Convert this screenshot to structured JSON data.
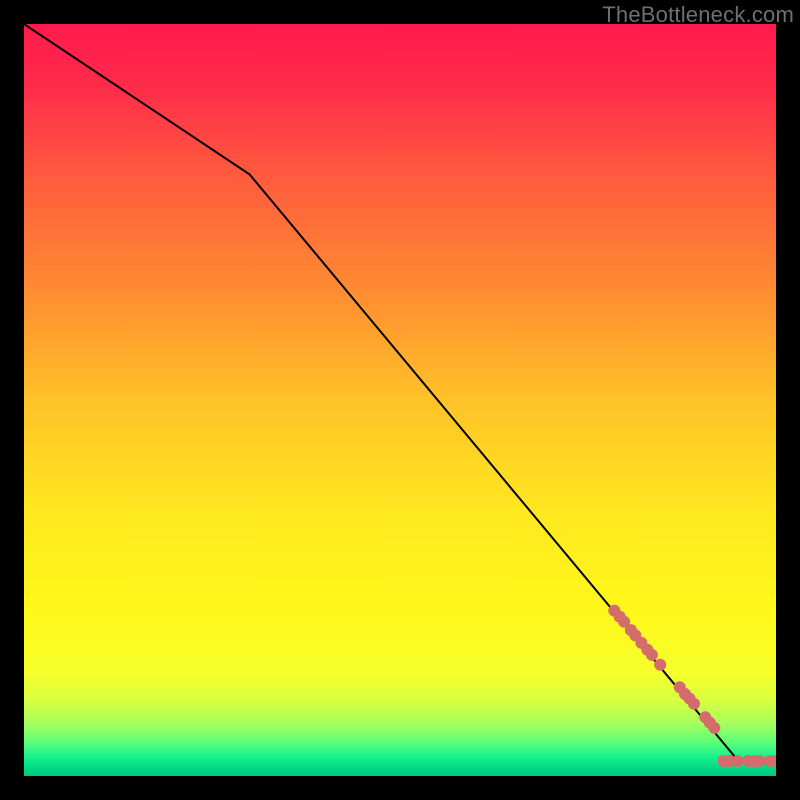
{
  "watermark": "TheBottleneck.com",
  "chart_data": {
    "type": "line",
    "title": "",
    "xlabel": "",
    "ylabel": "",
    "xlim": [
      0,
      100
    ],
    "ylim": [
      0,
      100
    ],
    "background": "heatmap-gradient",
    "line": {
      "x": [
        0,
        30,
        95,
        100
      ],
      "y": [
        100,
        80,
        2,
        2
      ]
    },
    "scatter": {
      "color": "#d46c6c",
      "radius": 6,
      "points": [
        {
          "x": 78.5,
          "y": 22.0
        },
        {
          "x": 79.2,
          "y": 21.2
        },
        {
          "x": 79.8,
          "y": 20.5
        },
        {
          "x": 80.7,
          "y": 19.4
        },
        {
          "x": 81.3,
          "y": 18.7
        },
        {
          "x": 82.1,
          "y": 17.7
        },
        {
          "x": 82.9,
          "y": 16.8
        },
        {
          "x": 83.5,
          "y": 16.1
        },
        {
          "x": 84.6,
          "y": 14.8
        },
        {
          "x": 87.2,
          "y": 11.8
        },
        {
          "x": 87.9,
          "y": 10.9
        },
        {
          "x": 88.5,
          "y": 10.3
        },
        {
          "x": 89.1,
          "y": 9.6
        },
        {
          "x": 90.6,
          "y": 7.8
        },
        {
          "x": 91.2,
          "y": 7.1
        },
        {
          "x": 91.8,
          "y": 6.4
        },
        {
          "x": 93.0,
          "y": 2.0
        },
        {
          "x": 93.8,
          "y": 2.0
        },
        {
          "x": 94.9,
          "y": 2.0
        },
        {
          "x": 96.3,
          "y": 2.0
        },
        {
          "x": 97.0,
          "y": 2.0
        },
        {
          "x": 97.8,
          "y": 2.0
        },
        {
          "x": 99.2,
          "y": 2.0
        },
        {
          "x": 100.0,
          "y": 2.0
        }
      ]
    },
    "gradient_stops": [
      {
        "offset": 0.0,
        "color": "#ff1a4d"
      },
      {
        "offset": 0.08,
        "color": "#ff2a4a"
      },
      {
        "offset": 0.2,
        "color": "#ff5a3e"
      },
      {
        "offset": 0.35,
        "color": "#ff8a32"
      },
      {
        "offset": 0.5,
        "color": "#ffc228"
      },
      {
        "offset": 0.65,
        "color": "#ffe820"
      },
      {
        "offset": 0.78,
        "color": "#fff81a"
      },
      {
        "offset": 0.86,
        "color": "#f7ff2a"
      },
      {
        "offset": 0.9,
        "color": "#d8ff40"
      },
      {
        "offset": 0.93,
        "color": "#a6ff5c"
      },
      {
        "offset": 0.955,
        "color": "#5cff7a"
      },
      {
        "offset": 0.975,
        "color": "#18f08c"
      },
      {
        "offset": 0.99,
        "color": "#00d884"
      },
      {
        "offset": 1.0,
        "color": "#00c87e"
      }
    ]
  }
}
